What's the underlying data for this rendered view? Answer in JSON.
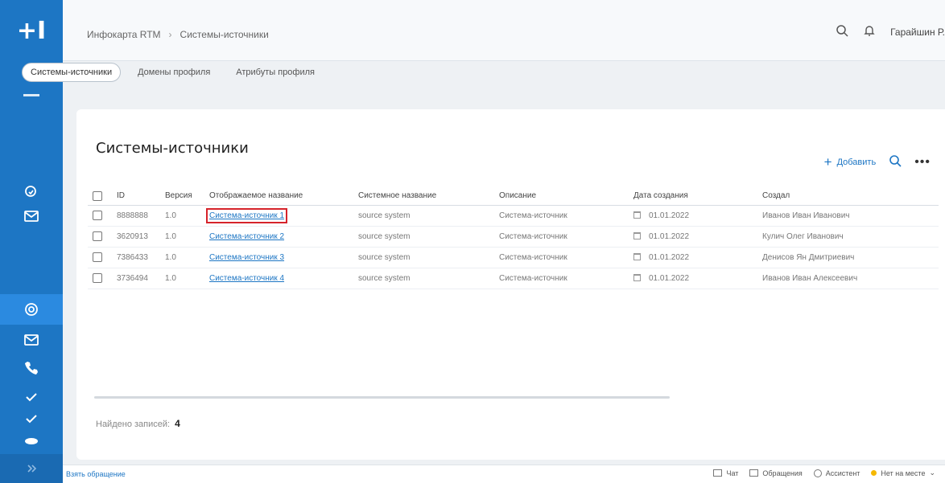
{
  "app": {
    "logo": "+I"
  },
  "breadcrumb": [
    "Инфокарта RTM",
    "Системы-источники"
  ],
  "header": {
    "user": "Гарайшин Р."
  },
  "subtabs": [
    "Системы-источники",
    "Домены профиля",
    "Атрибуты профиля"
  ],
  "page": {
    "title": "Системы-источники",
    "add_label": "Добавить"
  },
  "table": {
    "headers": [
      "ID",
      "Версия",
      "Отображаемое название",
      "Системное название",
      "Описание",
      "Дата создания",
      "Создал"
    ],
    "rows": [
      [
        "8888888",
        "1.0",
        "Система-источник 1",
        "source system",
        "Система-источник",
        "01.01.2022",
        "Иванов Иван Иванович"
      ],
      [
        "3620913",
        "1.0",
        "Система-источник 2",
        "source system",
        "Система-источник",
        "01.01.2022",
        "Кулич Олег Иванович"
      ],
      [
        "7386433",
        "1.0",
        "Система-источник 3",
        "source system",
        "Система-источник",
        "01.01.2022",
        "Денисов Ян Дмитриевич"
      ],
      [
        "3736494",
        "1.0",
        "Система-источник 4",
        "source system",
        "Система-источник",
        "01.01.2022",
        "Иванов Иван Алексеевич"
      ]
    ]
  },
  "found": {
    "label": "Найдено записей:",
    "count": "4"
  },
  "footer": {
    "left": "Взять обращение",
    "items": [
      "Чат",
      "Обращения",
      "Ассистент",
      "Нет на месте"
    ]
  },
  "colors": {
    "sidebar": "#1d76c4",
    "accent": "#1d76c4",
    "highlight": "#d6232b",
    "status": "#f5b800"
  }
}
